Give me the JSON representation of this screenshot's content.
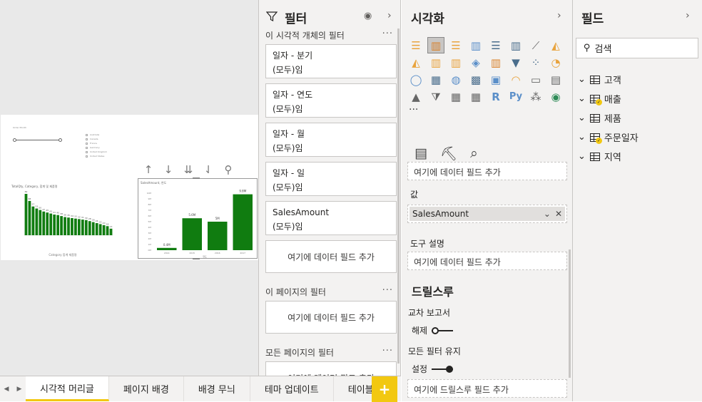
{
  "tabs": {
    "items": [
      "시각적 머리글",
      "페이지 배경",
      "배경 무늬",
      "테마 업데이트",
      "테이블"
    ],
    "add_label": "+"
  },
  "canvas": {
    "slicer_title": "Order Month",
    "legend_items": [
      "Australia",
      "Canada",
      "France",
      "Germany",
      "United Kingdom",
      "United States"
    ],
    "chart1_title": "TotalQty, Category, 합계 및 제품명",
    "chart1_xlabel": "Category 합계 제품명",
    "chart2_title": "SalesAmount, 연도",
    "chart2_xlabel": "연도"
  },
  "chart_data": [
    {
      "type": "bar",
      "title": "TotalQty, Category, 합계 및 제품명",
      "xlabel": "Category 합계 제품명",
      "values": [
        82,
        68,
        57,
        53,
        50,
        47,
        45,
        43,
        41,
        40,
        38,
        36,
        35,
        34,
        33,
        32,
        31,
        30,
        28,
        26,
        24,
        22,
        20,
        18,
        13
      ]
    },
    {
      "type": "bar",
      "title": "SalesAmount, 연도",
      "xlabel": "연도",
      "categories": [
        "2014",
        "2015",
        "2016",
        "2017"
      ],
      "values": [
        0.4,
        5.6,
        5.0,
        9.8
      ]
    }
  ],
  "visual_toolbar": {
    "icons": [
      "↑",
      "↓",
      "⇊",
      "⇃",
      "⚲"
    ]
  },
  "filters_pane": {
    "title": "필터",
    "visual_section": "이 시각적 개체의 필터",
    "cards": [
      {
        "field": "일자 - 분기",
        "value": "(모두)임"
      },
      {
        "field": "일자 - 연도",
        "value": "(모두)임"
      },
      {
        "field": "일자 - 월",
        "value": "(모두)임"
      },
      {
        "field": "일자 - 일",
        "value": "(모두)임"
      },
      {
        "field": "SalesAmount",
        "value": "(모두)임"
      }
    ],
    "add_field": "여기에 데이터 필드 추가",
    "page_section": "이 페이지의 필터",
    "all_pages_section": "모든 페이지의 필터",
    "more": "···"
  },
  "viz_pane": {
    "title": "시각화",
    "more_visuals": "···",
    "axis_placeholder": "여기에 데이터 필드 추가",
    "values_label": "값",
    "values_field": "SalesAmount",
    "tooltip_label": "도구 설명",
    "tooltip_placeholder": "여기에 데이터 필드 추가",
    "drillthrough_title": "드릴스루",
    "cross_report_label": "교차 보고서",
    "cross_report_state": "해제",
    "keep_filters_label": "모든 필터 유지",
    "keep_filters_state": "설정",
    "drillthrough_placeholder": "여기에 드릴스루 필드 추가"
  },
  "fields_pane": {
    "title": "필드",
    "search_placeholder": "검색",
    "tables": [
      {
        "name": "고객",
        "has_badge": false
      },
      {
        "name": "매출",
        "has_badge": true
      },
      {
        "name": "제품",
        "has_badge": false
      },
      {
        "name": "주문일자",
        "has_badge": true
      },
      {
        "name": "지역",
        "has_badge": false
      }
    ]
  },
  "colors": {
    "accent": "#f2c811",
    "bar": "#107c10",
    "pane_bg": "#f3f2f1",
    "canvas_bg": "#e9e9e9"
  }
}
